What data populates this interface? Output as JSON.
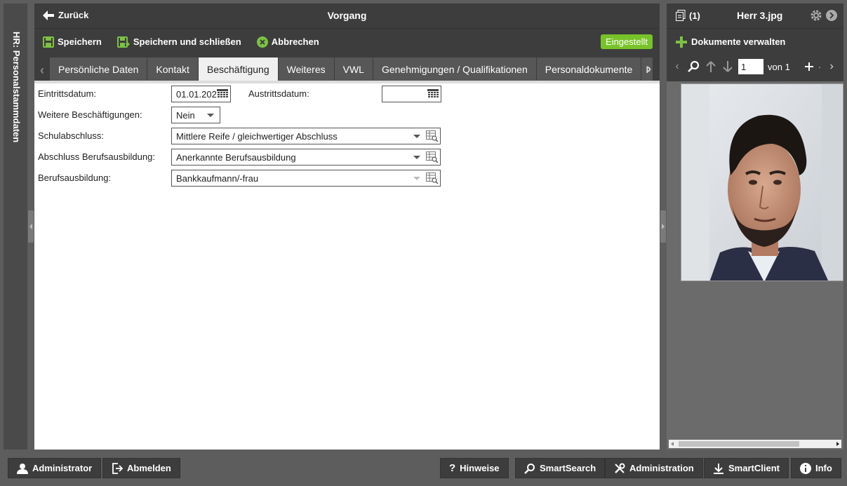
{
  "sidebar": {
    "title": "HR: Personalstammdaten"
  },
  "header": {
    "back_label": "Zurück",
    "title": "Vorgang"
  },
  "toolbar": {
    "save_label": "Speichern",
    "save_close_label": "Speichern und schließen",
    "cancel_label": "Abbrechen",
    "status": "Eingestellt",
    "status_color": "#78c32a"
  },
  "tabs": [
    {
      "label": "Persönliche Daten"
    },
    {
      "label": "Kontakt"
    },
    {
      "label": "Beschäftigung"
    },
    {
      "label": "Weiteres"
    },
    {
      "label": "VWL"
    },
    {
      "label": "Genehmigungen / Qualifikationen"
    },
    {
      "label": "Personaldokumente"
    },
    {
      "label": "I"
    }
  ],
  "active_tab": "Beschäftigung",
  "form": {
    "eintritt_label": "Eintrittsdatum:",
    "eintritt_value": "01.01.202",
    "austritt_label": "Austrittsdatum:",
    "austritt_value": "",
    "weitere_label": "Weitere Beschäftigungen:",
    "weitere_value": "Nein",
    "schule_label": "Schulabschluss:",
    "schule_value": "Mittlere Reife / gleichwertiger Abschluss",
    "abschluss_label": "Abschluss Berufsausbildung:",
    "abschluss_value": "Anerkannte Berufsausbildung",
    "beruf_label": "Berufsausbildung:",
    "beruf_value": "Bankkaufmann/-frau"
  },
  "docs": {
    "count": "(1)",
    "filename": "Herr 3.jpg",
    "manage_label": "Dokumente verwalten",
    "page_value": "1",
    "page_of": "von 1"
  },
  "bottom": {
    "user_label": "Administrator",
    "logout_label": "Abmelden",
    "hints_label": "Hinweise",
    "smartsearch_label": "SmartSearch",
    "admin_label": "Administration",
    "smartclient_label": "SmartClient",
    "info_label": "Info"
  }
}
